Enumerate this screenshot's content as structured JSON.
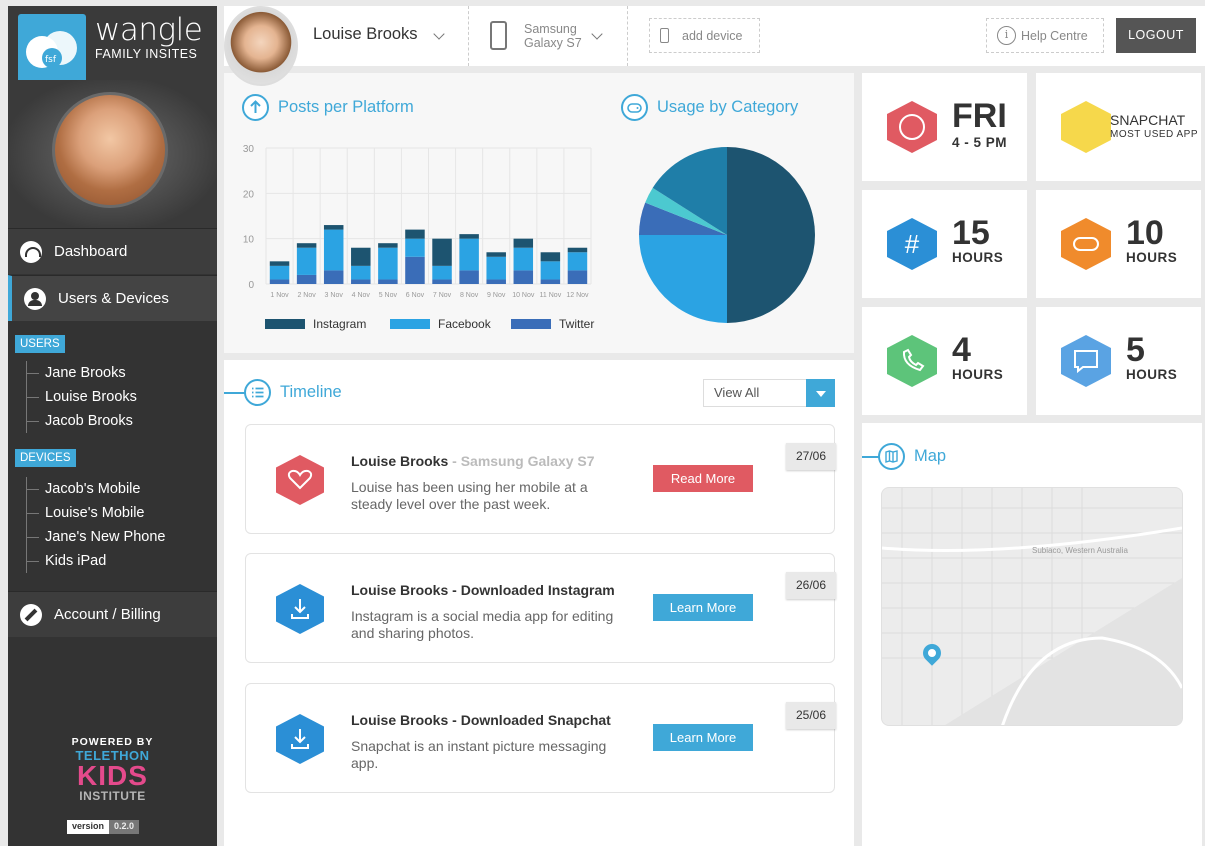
{
  "brand": {
    "title": "wangle",
    "subtitle": "FAMILY INSITES"
  },
  "sidebar": {
    "nav": [
      {
        "label": "Dashboard",
        "icon": "gauge-icon"
      },
      {
        "label": "Users & Devices",
        "icon": "user-icon"
      },
      {
        "label": "Account / Billing",
        "icon": "wrench-icon"
      }
    ],
    "users_tag": "USERS",
    "users": [
      "Jane Brooks",
      "Louise Brooks",
      "Jacob Brooks"
    ],
    "devices_tag": "DEVICES",
    "devices": [
      "Jacob's Mobile",
      "Louise's Mobile",
      "Jane's New Phone",
      "Kids iPad"
    ],
    "powered": {
      "line1": "POWERED BY",
      "line2": "TELETHON",
      "line3": "KIDS",
      "line4": "INSTITUTE"
    },
    "version": {
      "key": "version",
      "value": "0.2.0"
    }
  },
  "topbar": {
    "user": "Louise Brooks",
    "device_line1": "Samsung",
    "device_line2": "Galaxy S7",
    "add_device": "add device",
    "help": "Help Centre",
    "logout": "LOGOUT"
  },
  "posts": {
    "title": "Posts per Platform"
  },
  "usage": {
    "title": "Usage by Category"
  },
  "colors": {
    "accent": "#3fa8d8",
    "instagram": "#1d5470",
    "facebook": "#2ba3e3",
    "twitter": "#3a6db8",
    "red": "#e05a62"
  },
  "chart_data": [
    {
      "type": "bar",
      "title": "Posts per Platform",
      "categories": [
        "1 Nov",
        "2 Nov",
        "3 Nov",
        "4 Nov",
        "5 Nov",
        "6 Nov",
        "7 Nov",
        "8 Nov",
        "9 Nov",
        "10 Nov",
        "11 Nov",
        "12 Nov"
      ],
      "ylim": [
        0,
        30
      ],
      "yticks": [
        0,
        10,
        20,
        30
      ],
      "stacked": true,
      "series": [
        {
          "name": "Twitter",
          "values": [
            1,
            2,
            3,
            1,
            1,
            6,
            1,
            3,
            1,
            3,
            1,
            3
          ]
        },
        {
          "name": "Facebook",
          "values": [
            3,
            6,
            9,
            3,
            7,
            4,
            3,
            7,
            5,
            5,
            4,
            4
          ]
        },
        {
          "name": "Instagram",
          "values": [
            1,
            1,
            1,
            4,
            1,
            2,
            6,
            1,
            1,
            2,
            2,
            1
          ]
        }
      ],
      "legend": "bottom"
    },
    {
      "type": "pie",
      "title": "Usage by Category",
      "slices": [
        {
          "value": 50,
          "color": "#1d5470"
        },
        {
          "value": 25,
          "color": "#2ba3e3"
        },
        {
          "value": 6,
          "color": "#3a6db8"
        },
        {
          "value": 3,
          "color": "#4cc9d0"
        },
        {
          "value": 16,
          "color": "#1f7ea8"
        }
      ]
    }
  ],
  "stats": [
    {
      "big": "FRI",
      "small": "4 - 5 PM",
      "color": "#e05a62",
      "icon": "clock-icon"
    },
    {
      "big": "SNAPCHAT",
      "small": "MOST USED APP",
      "color": "#f6d84b",
      "icon": "snapchat-icon"
    },
    {
      "big": "15",
      "small": "HOURS",
      "color": "#2b8fd6",
      "icon": "hashtag-icon"
    },
    {
      "big": "10",
      "small": "HOURS",
      "color": "#f08b2c",
      "icon": "gamepad-icon"
    },
    {
      "big": "4",
      "small": "HOURS",
      "color": "#5dc47a",
      "icon": "phone-call-icon"
    },
    {
      "big": "5",
      "small": "HOURS",
      "color": "#5aa3e3",
      "icon": "chat-icon"
    }
  ],
  "timeline": {
    "title": "Timeline",
    "filter": "View All",
    "items": [
      {
        "name": "Louise Brooks",
        "sep": " - ",
        "device": "Samsung Galaxy S7",
        "action": "",
        "body": "Louise has been using her mobile at a steady level over the past week.",
        "button": "Read More",
        "date": "27/06",
        "color": "#e05a62",
        "btn_color": "#e05a62",
        "icon": "heart-icon"
      },
      {
        "name": "Louise Brooks",
        "sep": " - ",
        "device": "",
        "action": "Downloaded Instagram",
        "body": "Instagram is a social media app for editing and sharing photos.",
        "button": "Learn More",
        "date": "26/06",
        "color": "#2b8fd6",
        "btn_color": "#3fa8d8",
        "icon": "download-icon"
      },
      {
        "name": "Louise Brooks",
        "sep": " - ",
        "device": "",
        "action": "Downloaded Snapchat",
        "body": "Snapchat is an instant picture messaging app.",
        "button": "Learn More",
        "date": "25/06",
        "color": "#2b8fd6",
        "btn_color": "#3fa8d8",
        "icon": "download-icon"
      }
    ]
  },
  "map": {
    "title": "Map",
    "place": "Subiaco, Western Australia"
  }
}
